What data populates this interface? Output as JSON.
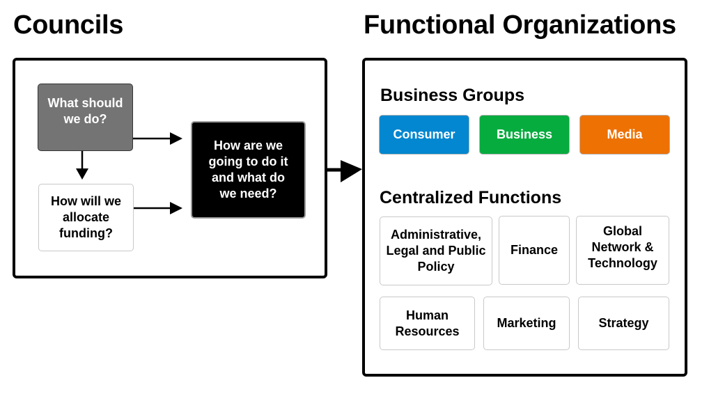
{
  "councils": {
    "title": "Councils",
    "steps": {
      "what": "What should we do?",
      "funding": "How will we allocate funding?",
      "how": "How are we going to do it and what do we need?"
    }
  },
  "functional": {
    "title": "Functional Organizations",
    "business_groups": {
      "heading": "Business Groups",
      "items": [
        {
          "label": "Consumer",
          "color": "#0287d0"
        },
        {
          "label": "Business",
          "color": "#07ac3f"
        },
        {
          "label": "Media",
          "color": "#ee7103"
        }
      ]
    },
    "centralized": {
      "heading": "Centralized Functions",
      "items": [
        {
          "label": "Administrative, Legal and Public Policy"
        },
        {
          "label": "Finance"
        },
        {
          "label": "Global Network & Technology"
        },
        {
          "label": "Human Resources"
        },
        {
          "label": "Marketing"
        },
        {
          "label": "Strategy"
        }
      ]
    }
  }
}
